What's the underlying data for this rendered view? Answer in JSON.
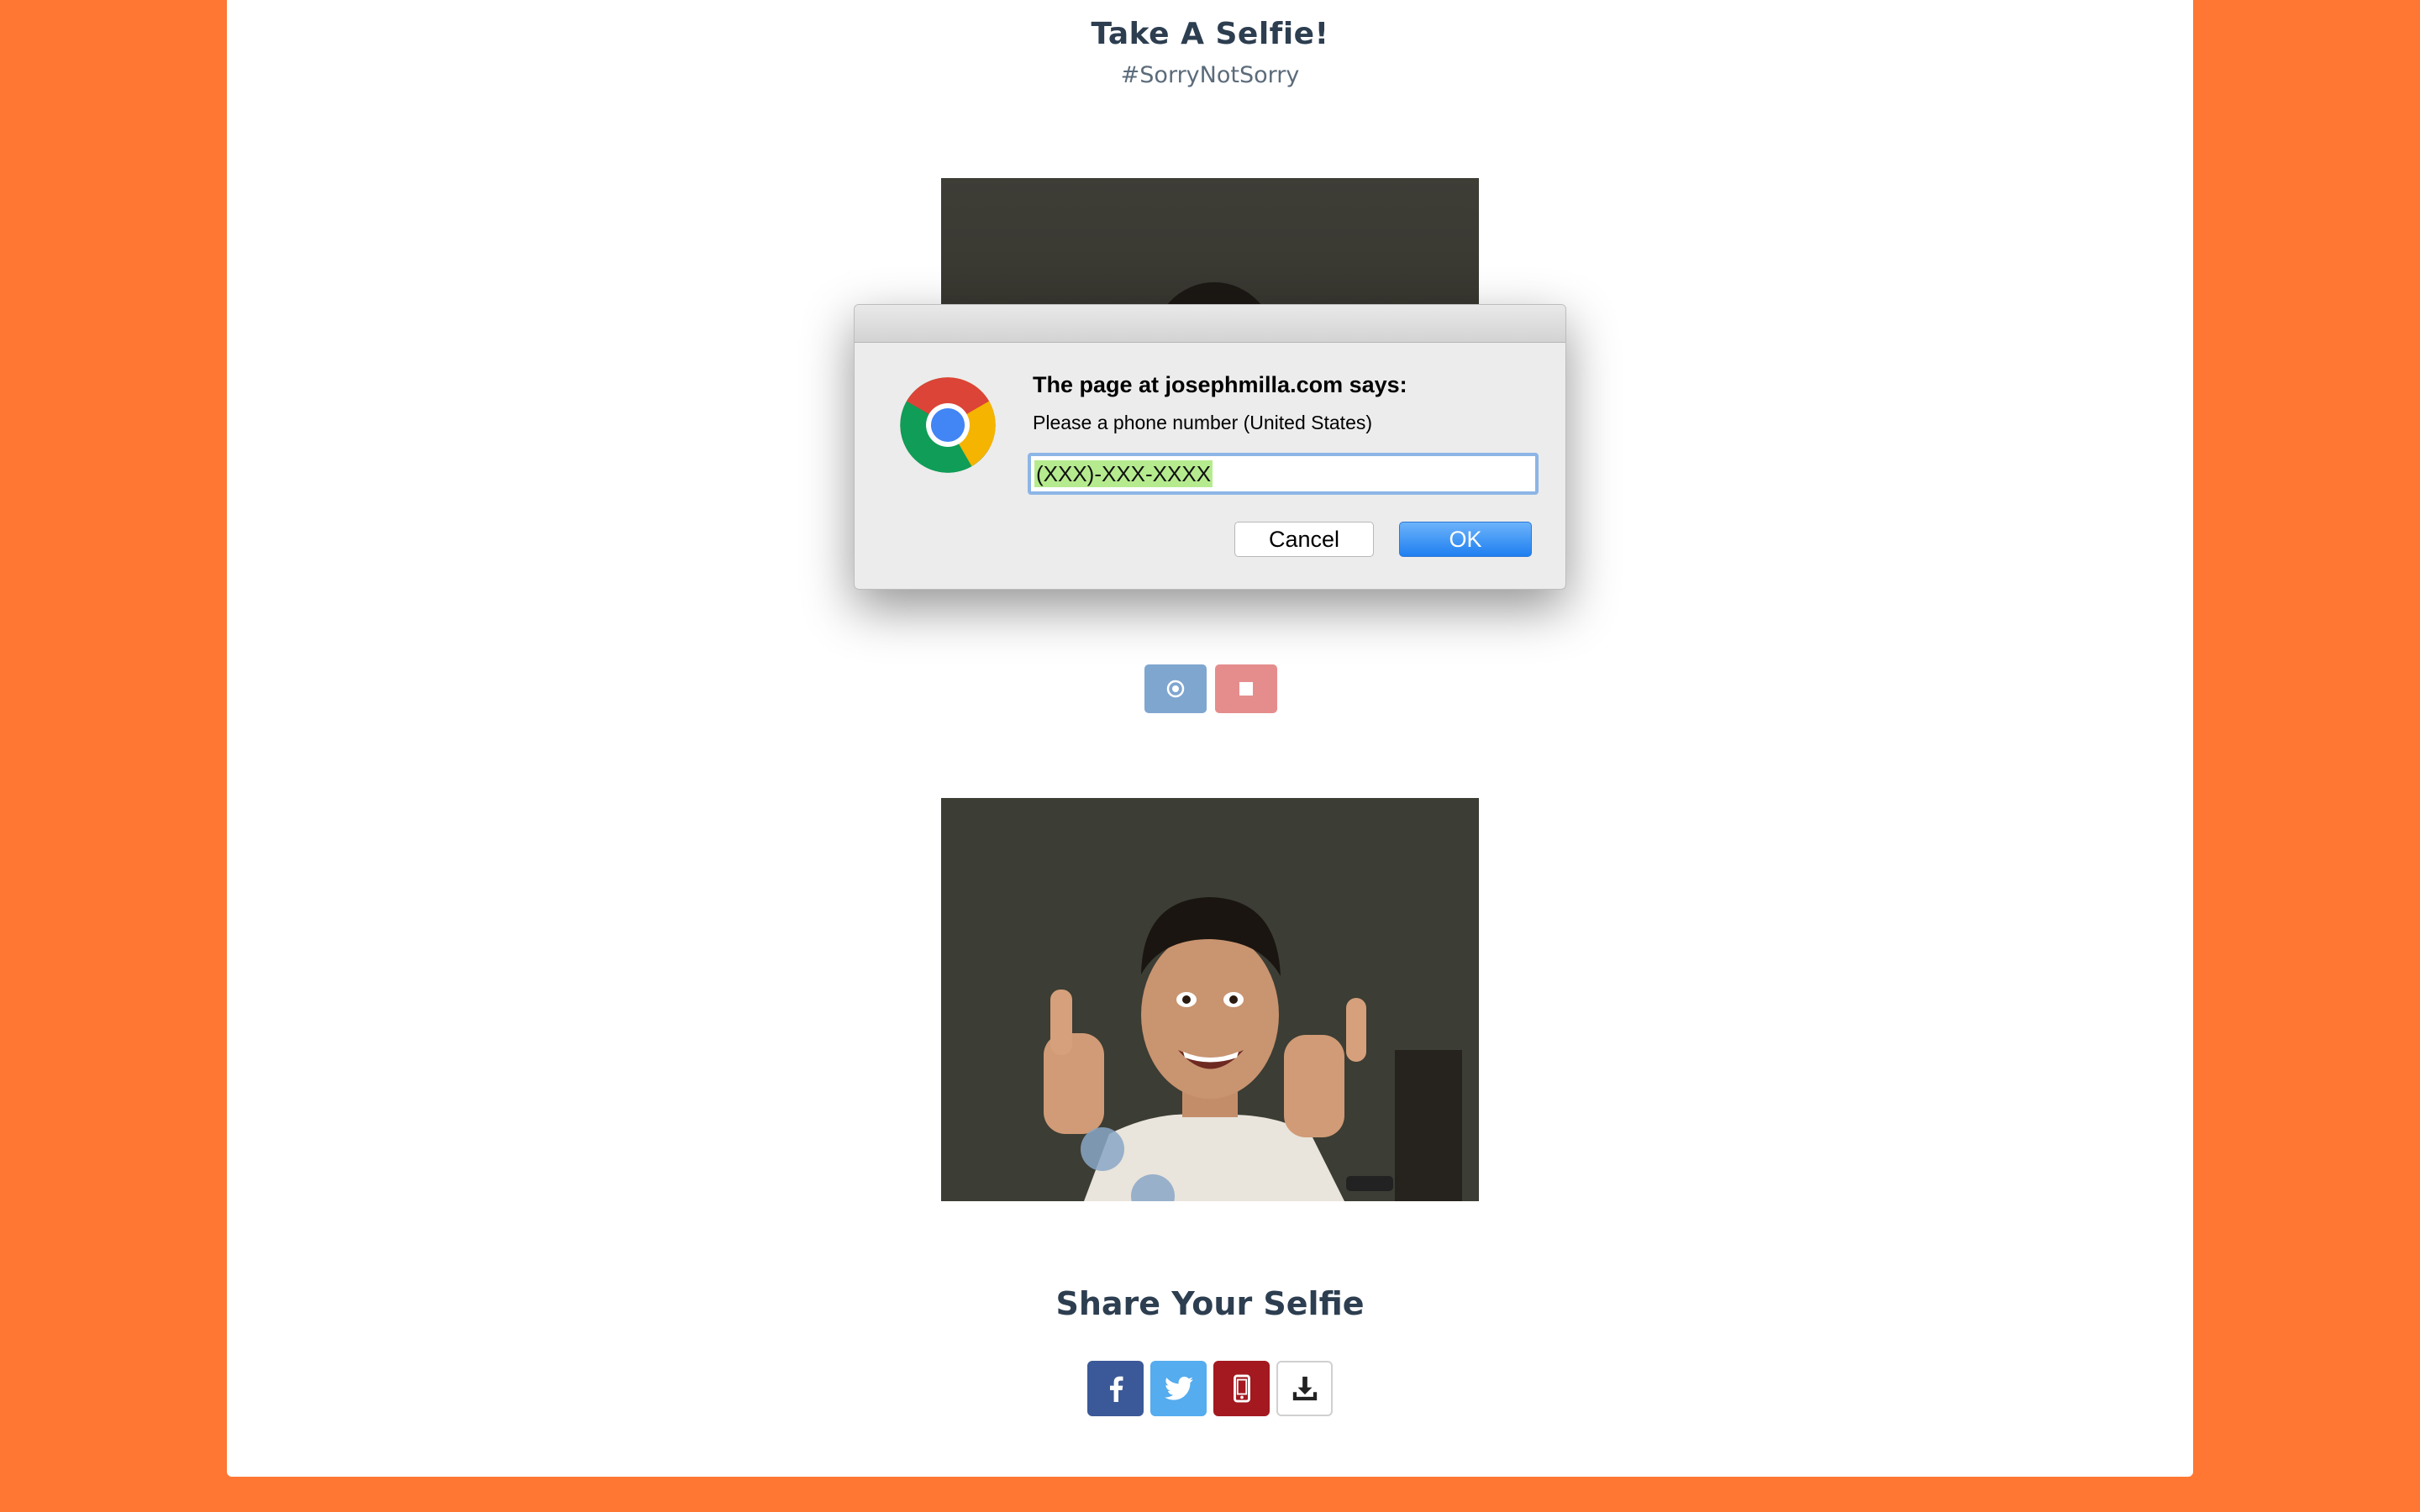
{
  "page": {
    "title": "Take A Selfie!",
    "subtitle": "#SorryNotSorry",
    "share_title": "Share Your Selfie"
  },
  "controls": [
    {
      "name": "capture-button",
      "icon": "record-icon"
    },
    {
      "name": "stop-button",
      "icon": "stop-icon"
    }
  ],
  "share_buttons": [
    {
      "name": "facebook-share-button",
      "icon": "facebook-icon",
      "color": "#3b5998"
    },
    {
      "name": "twitter-share-button",
      "icon": "twitter-icon",
      "color": "#55acee"
    },
    {
      "name": "phone-share-button",
      "icon": "mobile-phone-icon",
      "color": "#a3191f"
    },
    {
      "name": "download-button",
      "icon": "download-icon",
      "color": "#ffffff"
    }
  ],
  "dialog": {
    "heading": "The page at josephmilla.com says:",
    "message": "Please a phone number (United States)",
    "input_value": "(XXX)-XXX-XXXX",
    "cancel_label": "Cancel",
    "ok_label": "OK",
    "icon": "chrome-logo-icon"
  },
  "colors": {
    "background": "#ff7733",
    "card": "#ffffff",
    "heading_text": "#2d3e50",
    "ok_button": "#1f7ff0"
  }
}
